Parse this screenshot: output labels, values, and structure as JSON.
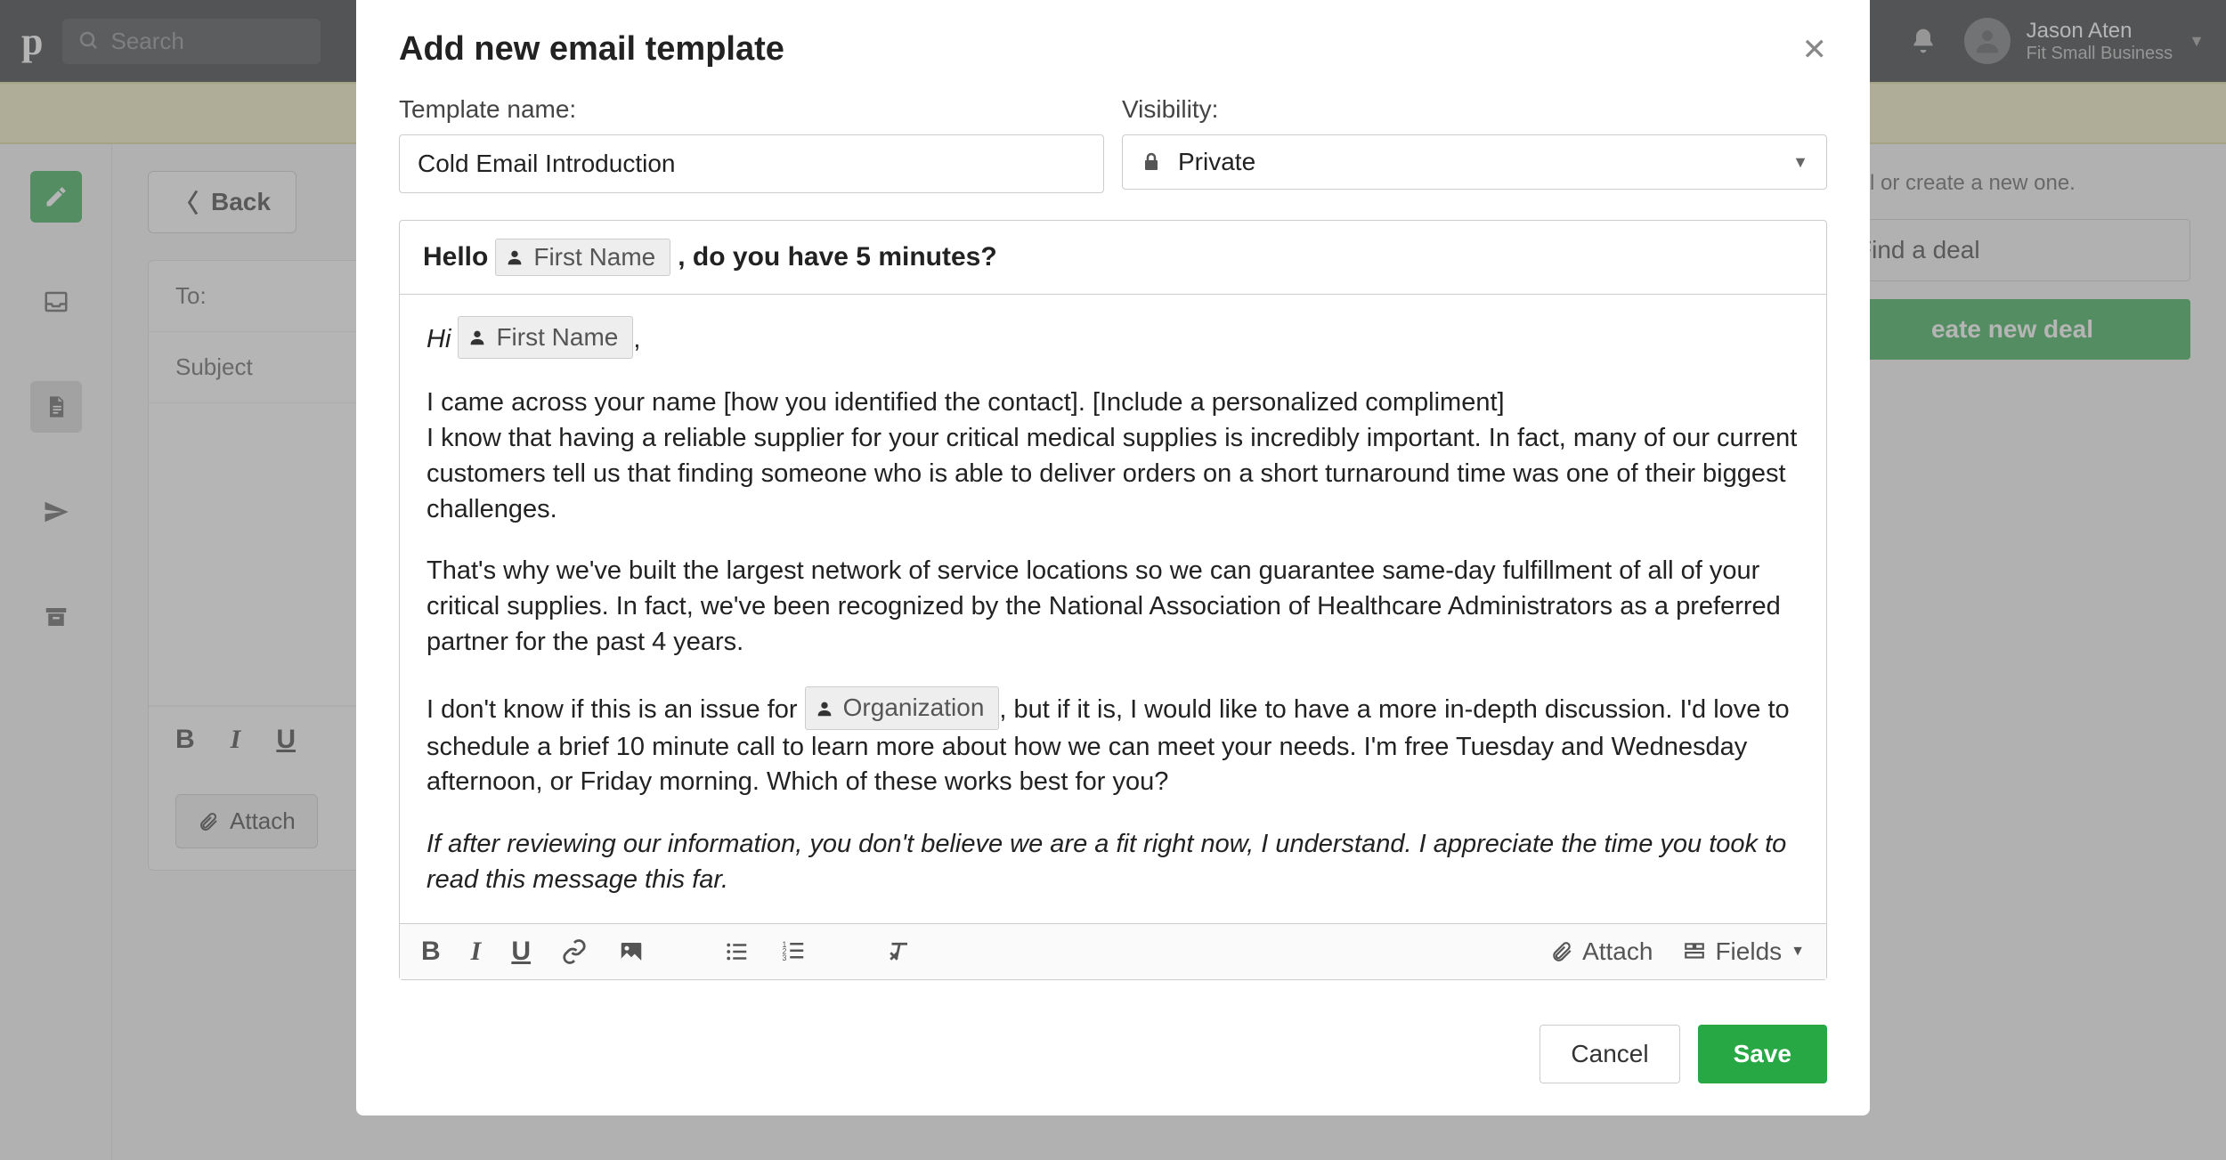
{
  "topbar": {
    "search_placeholder": "Search",
    "user_name": "Jason Aten",
    "user_company": "Fit Small Business"
  },
  "leftRail": {
    "items": [
      "edit",
      "inbox",
      "document",
      "send",
      "archive"
    ]
  },
  "compose": {
    "back_label": "Back",
    "to_label": "To:",
    "subject_label": "Subject",
    "attach_label": "Attach"
  },
  "rightPanel": {
    "hint_text": "deal or create a new one.",
    "find_deal_label": "Find a deal",
    "create_deal_label": "eate new deal"
  },
  "modal": {
    "title": "Add new email template",
    "template_name_label": "Template name:",
    "template_name_value": "Cold Email Introduction",
    "visibility_label": "Visibility:",
    "visibility_value": "Private",
    "subject": {
      "prefix": "Hello",
      "merge1": "First Name",
      "suffix": ", do you have 5 minutes?"
    },
    "body": {
      "greeting_prefix": "Hi",
      "greeting_merge": "First Name",
      "greeting_suffix": ",",
      "p1": "I came across your name [how you identified the contact]. [Include a personalized compliment]",
      "p2": "I know that having a reliable supplier for your critical medical supplies is incredibly important. In fact, many of our current customers tell us that finding someone who is able to deliver orders on a short turnaround time was one of their biggest challenges.",
      "p3": "That's why we've built the largest network of service locations so we can guarantee same-day fulfillment of all of your critical supplies. In fact, we've been recognized by the National Association of Healthcare Administrators as a preferred partner for the past 4 years.",
      "p4_prefix": "I don't know if this is an issue for",
      "p4_merge": "Organization",
      "p4_suffix": ", but if it is, I would like to have a more in-depth discussion. I'd love to schedule a brief 10 minute call to learn more about how we can meet your needs. I'm free Tuesday and Wednesday afternoon, or Friday morning. Which of these works best for you?",
      "p5": "If after reviewing our information, you don't believe we are a fit right now, I understand. I appreciate the time you took to read this message this far."
    },
    "toolbar": {
      "attach_label": "Attach",
      "fields_label": "Fields"
    },
    "cancel_label": "Cancel",
    "save_label": "Save"
  }
}
